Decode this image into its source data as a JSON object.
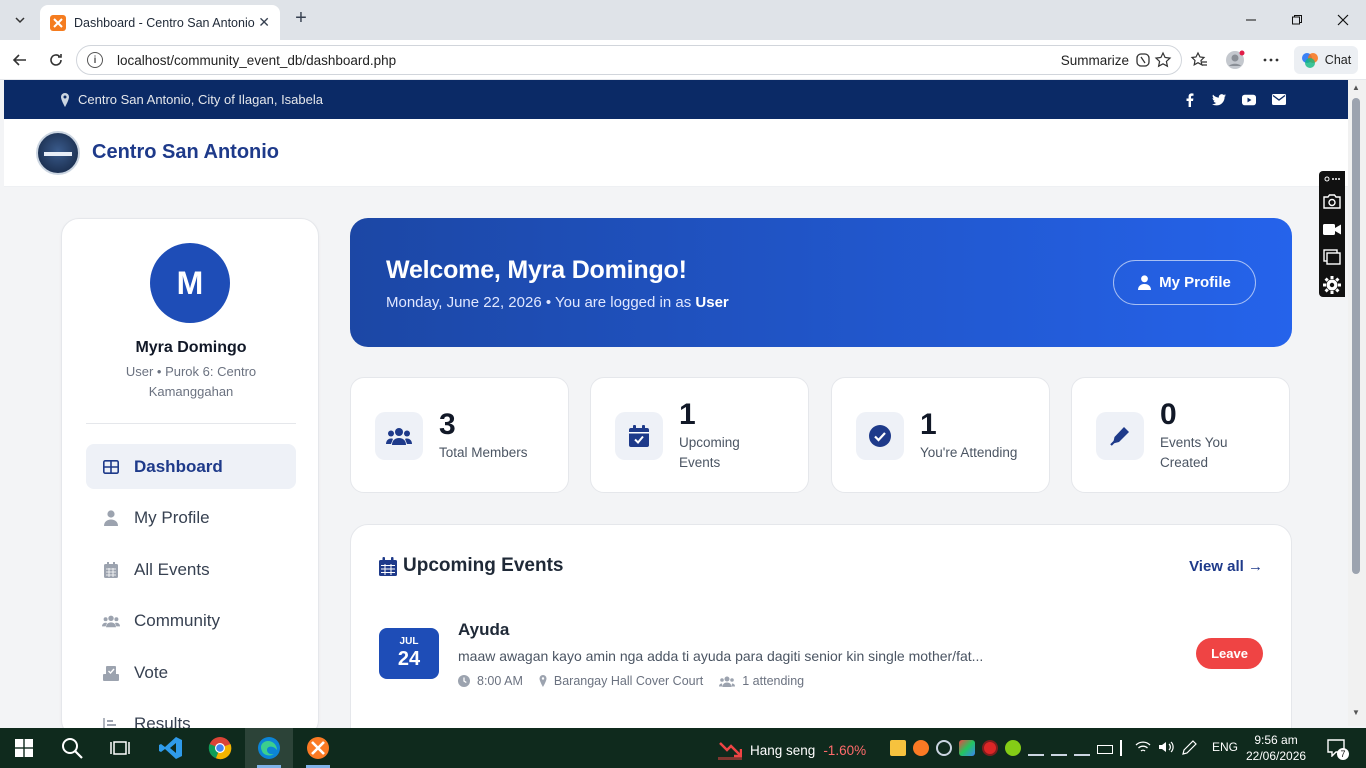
{
  "browser": {
    "tab_title": "Dashboard - Centro San Antonio",
    "url": "localhost/community_event_db/dashboard.php",
    "summarize_label": "Summarize",
    "chat_label": "Chat"
  },
  "topbar": {
    "location": "Centro San Antonio, City of Ilagan, Isabela",
    "social_icons": [
      "facebook-icon",
      "twitter-icon",
      "youtube-icon",
      "mail-icon"
    ]
  },
  "header": {
    "brand": "Centro San Antonio"
  },
  "sidebar": {
    "avatar_letter": "M",
    "user_name": "Myra Domingo",
    "user_role": "User • Purok 6: Centro Kamanggahan",
    "items": [
      {
        "label": "Dashboard",
        "icon": "grid-icon",
        "active": true
      },
      {
        "label": "My Profile",
        "icon": "user-icon",
        "active": false
      },
      {
        "label": "All Events",
        "icon": "calendar-icon",
        "active": false
      },
      {
        "label": "Community",
        "icon": "users-icon",
        "active": false
      },
      {
        "label": "Vote",
        "icon": "vote-box-icon",
        "active": false
      },
      {
        "label": "Results",
        "icon": "bar-list-icon",
        "active": false
      }
    ]
  },
  "welcome": {
    "title": "Welcome, Myra Domingo!",
    "subtitle_prefix": "Monday, June 22, 2026 • You are logged in as",
    "role": "User",
    "profile_button": "My Profile"
  },
  "stats": [
    {
      "value": "3",
      "label": "Total Members",
      "icon": "users-icon"
    },
    {
      "value": "1",
      "label": "Upcoming Events",
      "icon": "calendar-check-icon"
    },
    {
      "value": "1",
      "label": "You're Attending",
      "icon": "check-circle-icon"
    },
    {
      "value": "0",
      "label": "Events You Created",
      "icon": "pen-icon"
    }
  ],
  "upcoming": {
    "title": "Upcoming Events",
    "view_all": "View all →",
    "events": [
      {
        "month": "JUL",
        "day": "24",
        "title": "Ayuda",
        "description": "maaw awagan kayo amin nga adda ti ayuda para dagiti senior kin single mother/fat...",
        "time": "8:00 AM",
        "venue": "Barangay Hall Cover Court",
        "attending": "1 attending",
        "action": "Leave"
      }
    ]
  },
  "taskbar": {
    "ticker_name": "Hang seng",
    "ticker_change": "-1.60%",
    "language": "ENG",
    "time": "9:56 am",
    "date": "22/06/2026",
    "notification_count": "7"
  },
  "colors": {
    "navy": "#0b2a66",
    "brand_blue": "#1e3a8a",
    "accent_blue": "#2563eb",
    "danger": "#ef4444"
  }
}
